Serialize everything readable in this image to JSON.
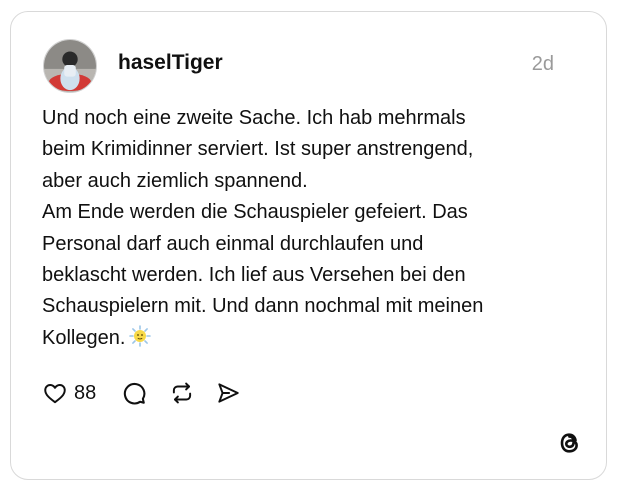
{
  "post": {
    "username": "haselTiger",
    "timestamp": "2d",
    "text": "Und noch eine zweite Sache. Ich hab mehrmals\nbeim Krimidinner serviert. Ist super anstrengend,\naber auch ziemlich spannend.\nAm Ende werden die Schauspieler gefeiert. Das\nPersonal darf auch einmal durchlaufen und\nbeklascht werden. Ich lief aus Versehen bei den\nSchauspielern mit. Und dann nochmal mit meinen\nKollegen.",
    "emoji": "sweat-smile-sun-emoji"
  },
  "actions": {
    "like_count": "88",
    "like_icon": "heart-icon",
    "comment_icon": "comment-icon",
    "repost_icon": "repost-icon",
    "share_icon": "send-icon"
  },
  "brand": {
    "logo": "threads-logo-icon"
  }
}
